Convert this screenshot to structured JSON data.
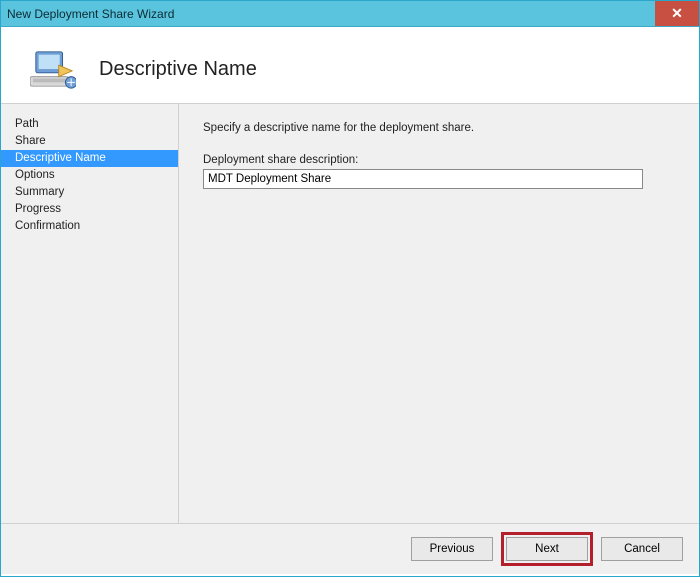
{
  "window": {
    "title": "New Deployment Share Wizard"
  },
  "header": {
    "page_title": "Descriptive Name",
    "icon": "computer-deploy-icon"
  },
  "sidebar": {
    "items": [
      {
        "label": "Path",
        "selected": false
      },
      {
        "label": "Share",
        "selected": false
      },
      {
        "label": "Descriptive Name",
        "selected": true
      },
      {
        "label": "Options",
        "selected": false
      },
      {
        "label": "Summary",
        "selected": false
      },
      {
        "label": "Progress",
        "selected": false
      },
      {
        "label": "Confirmation",
        "selected": false
      }
    ]
  },
  "main": {
    "instruction": "Specify a descriptive name for the deployment share.",
    "field_label": "Deployment share description:",
    "field_value": "MDT Deployment Share"
  },
  "footer": {
    "previous": "Previous",
    "next": "Next",
    "cancel": "Cancel"
  }
}
